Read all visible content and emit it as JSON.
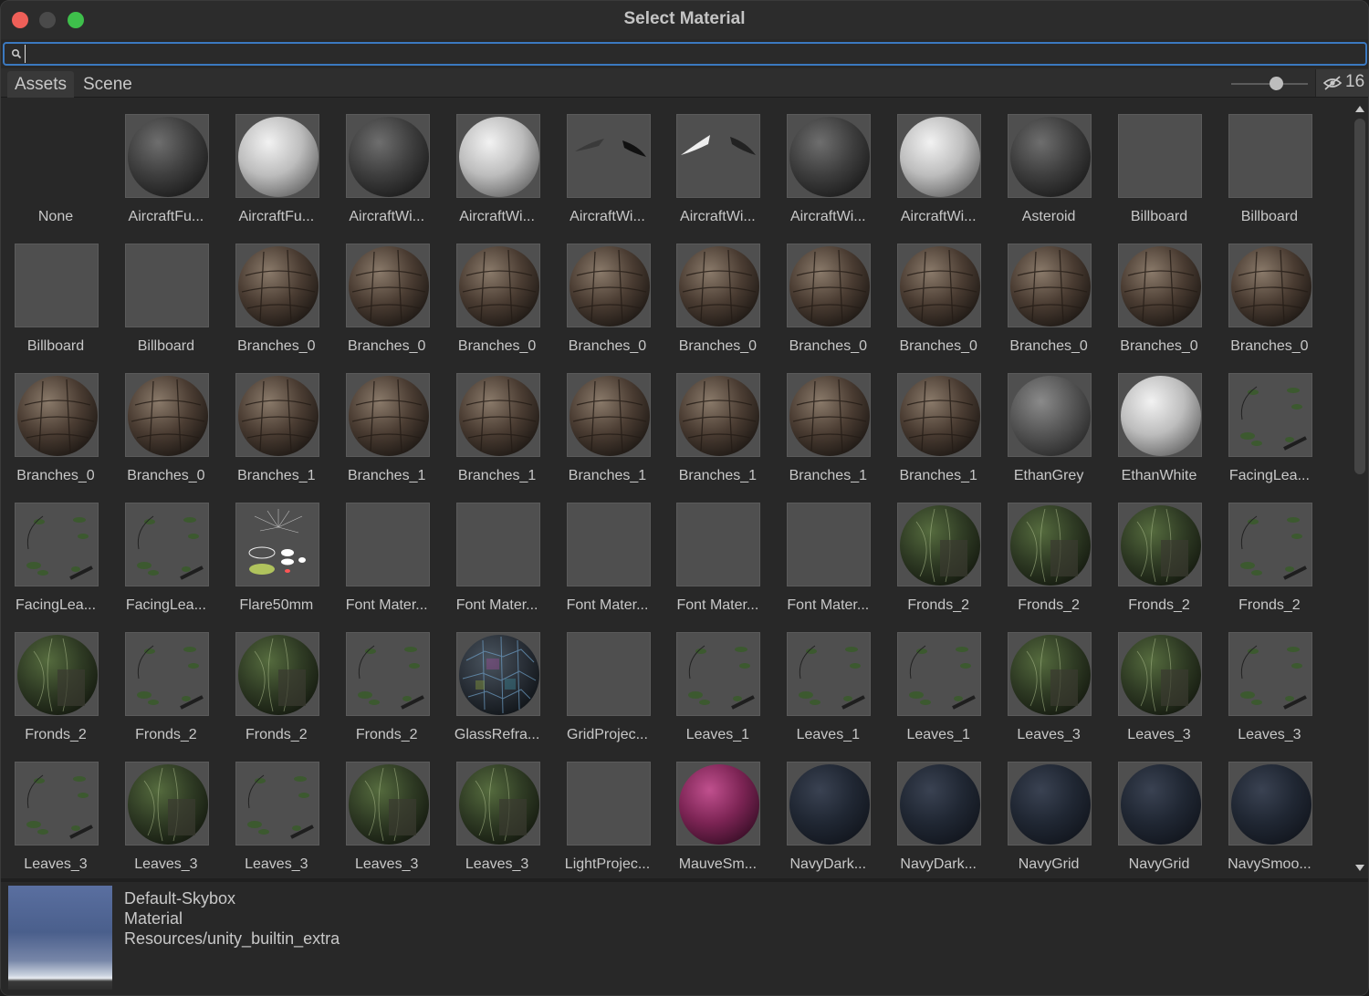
{
  "window": {
    "title": "Select Material"
  },
  "search": {
    "value": "",
    "placeholder": ""
  },
  "tabs": [
    {
      "label": "Assets",
      "active": true
    },
    {
      "label": "Scene",
      "active": false
    }
  ],
  "toolbar": {
    "hidden_count": "16",
    "zoom_slider_value": 0.6
  },
  "items": [
    {
      "label": "None",
      "preview": "none"
    },
    {
      "label": "AircraftFu...",
      "preview": "sphere-dark"
    },
    {
      "label": "AircraftFu...",
      "preview": "sphere-light"
    },
    {
      "label": "AircraftWi...",
      "preview": "sphere-dark"
    },
    {
      "label": "AircraftWi...",
      "preview": "sphere-light"
    },
    {
      "label": "AircraftWi...",
      "preview": "wing-dark"
    },
    {
      "label": "AircraftWi...",
      "preview": "wing-light"
    },
    {
      "label": "AircraftWi...",
      "preview": "sphere-dark"
    },
    {
      "label": "AircraftWi...",
      "preview": "sphere-light"
    },
    {
      "label": "Asteroid",
      "preview": "sphere-dark"
    },
    {
      "label": "Billboard",
      "preview": "blank"
    },
    {
      "label": "Billboard",
      "preview": "blank"
    },
    {
      "label": "Billboard",
      "preview": "blank"
    },
    {
      "label": "Billboard",
      "preview": "blank"
    },
    {
      "label": "Branches_0",
      "preview": "bark"
    },
    {
      "label": "Branches_0",
      "preview": "bark"
    },
    {
      "label": "Branches_0",
      "preview": "bark"
    },
    {
      "label": "Branches_0",
      "preview": "bark"
    },
    {
      "label": "Branches_0",
      "preview": "bark"
    },
    {
      "label": "Branches_0",
      "preview": "bark"
    },
    {
      "label": "Branches_0",
      "preview": "bark"
    },
    {
      "label": "Branches_0",
      "preview": "bark"
    },
    {
      "label": "Branches_0",
      "preview": "bark"
    },
    {
      "label": "Branches_0",
      "preview": "bark"
    },
    {
      "label": "Branches_0",
      "preview": "bark"
    },
    {
      "label": "Branches_0",
      "preview": "bark"
    },
    {
      "label": "Branches_1",
      "preview": "bark"
    },
    {
      "label": "Branches_1",
      "preview": "bark"
    },
    {
      "label": "Branches_1",
      "preview": "bark"
    },
    {
      "label": "Branches_1",
      "preview": "bark"
    },
    {
      "label": "Branches_1",
      "preview": "bark"
    },
    {
      "label": "Branches_1",
      "preview": "bark"
    },
    {
      "label": "Branches_1",
      "preview": "bark"
    },
    {
      "label": "EthanGrey",
      "preview": "sphere-mid"
    },
    {
      "label": "EthanWhite",
      "preview": "sphere-light"
    },
    {
      "label": "FacingLea...",
      "preview": "leaves"
    },
    {
      "label": "FacingLea...",
      "preview": "leaves"
    },
    {
      "label": "FacingLea...",
      "preview": "leaves"
    },
    {
      "label": "Flare50mm",
      "preview": "flare"
    },
    {
      "label": "Font Mater...",
      "preview": "blank"
    },
    {
      "label": "Font Mater...",
      "preview": "blank"
    },
    {
      "label": "Font Mater...",
      "preview": "blank"
    },
    {
      "label": "Font Mater...",
      "preview": "blank"
    },
    {
      "label": "Font Mater...",
      "preview": "blank"
    },
    {
      "label": "Fronds_2",
      "preview": "fronds"
    },
    {
      "label": "Fronds_2",
      "preview": "fronds"
    },
    {
      "label": "Fronds_2",
      "preview": "fronds"
    },
    {
      "label": "Fronds_2",
      "preview": "leaves"
    },
    {
      "label": "Fronds_2",
      "preview": "fronds"
    },
    {
      "label": "Fronds_2",
      "preview": "leaves"
    },
    {
      "label": "Fronds_2",
      "preview": "fronds"
    },
    {
      "label": "Fronds_2",
      "preview": "leaves"
    },
    {
      "label": "GlassRefra...",
      "preview": "glass"
    },
    {
      "label": "GridProjec...",
      "preview": "blank"
    },
    {
      "label": "Leaves_1",
      "preview": "leaves"
    },
    {
      "label": "Leaves_1",
      "preview": "leaves"
    },
    {
      "label": "Leaves_1",
      "preview": "leaves"
    },
    {
      "label": "Leaves_3",
      "preview": "fronds"
    },
    {
      "label": "Leaves_3",
      "preview": "fronds"
    },
    {
      "label": "Leaves_3",
      "preview": "leaves"
    },
    {
      "label": "Leaves_3",
      "preview": "leaves"
    },
    {
      "label": "Leaves_3",
      "preview": "fronds"
    },
    {
      "label": "Leaves_3",
      "preview": "leaves"
    },
    {
      "label": "Leaves_3",
      "preview": "fronds"
    },
    {
      "label": "Leaves_3",
      "preview": "fronds"
    },
    {
      "label": "LightProjec...",
      "preview": "blank"
    },
    {
      "label": "MauveSm...",
      "preview": "sphere-mauve"
    },
    {
      "label": "NavyDark...",
      "preview": "sphere-navy"
    },
    {
      "label": "NavyDark...",
      "preview": "sphere-navy"
    },
    {
      "label": "NavyGrid",
      "preview": "sphere-navy"
    },
    {
      "label": "NavyGrid",
      "preview": "sphere-navy"
    },
    {
      "label": "NavySmoo...",
      "preview": "sphere-navy"
    }
  ],
  "selection": {
    "name": "Default-Skybox",
    "type": "Material",
    "path": "Resources/unity_builtin_extra"
  },
  "colors": {
    "accent": "#3b79c0",
    "background": "#282828",
    "text": "#c8c8c8"
  }
}
